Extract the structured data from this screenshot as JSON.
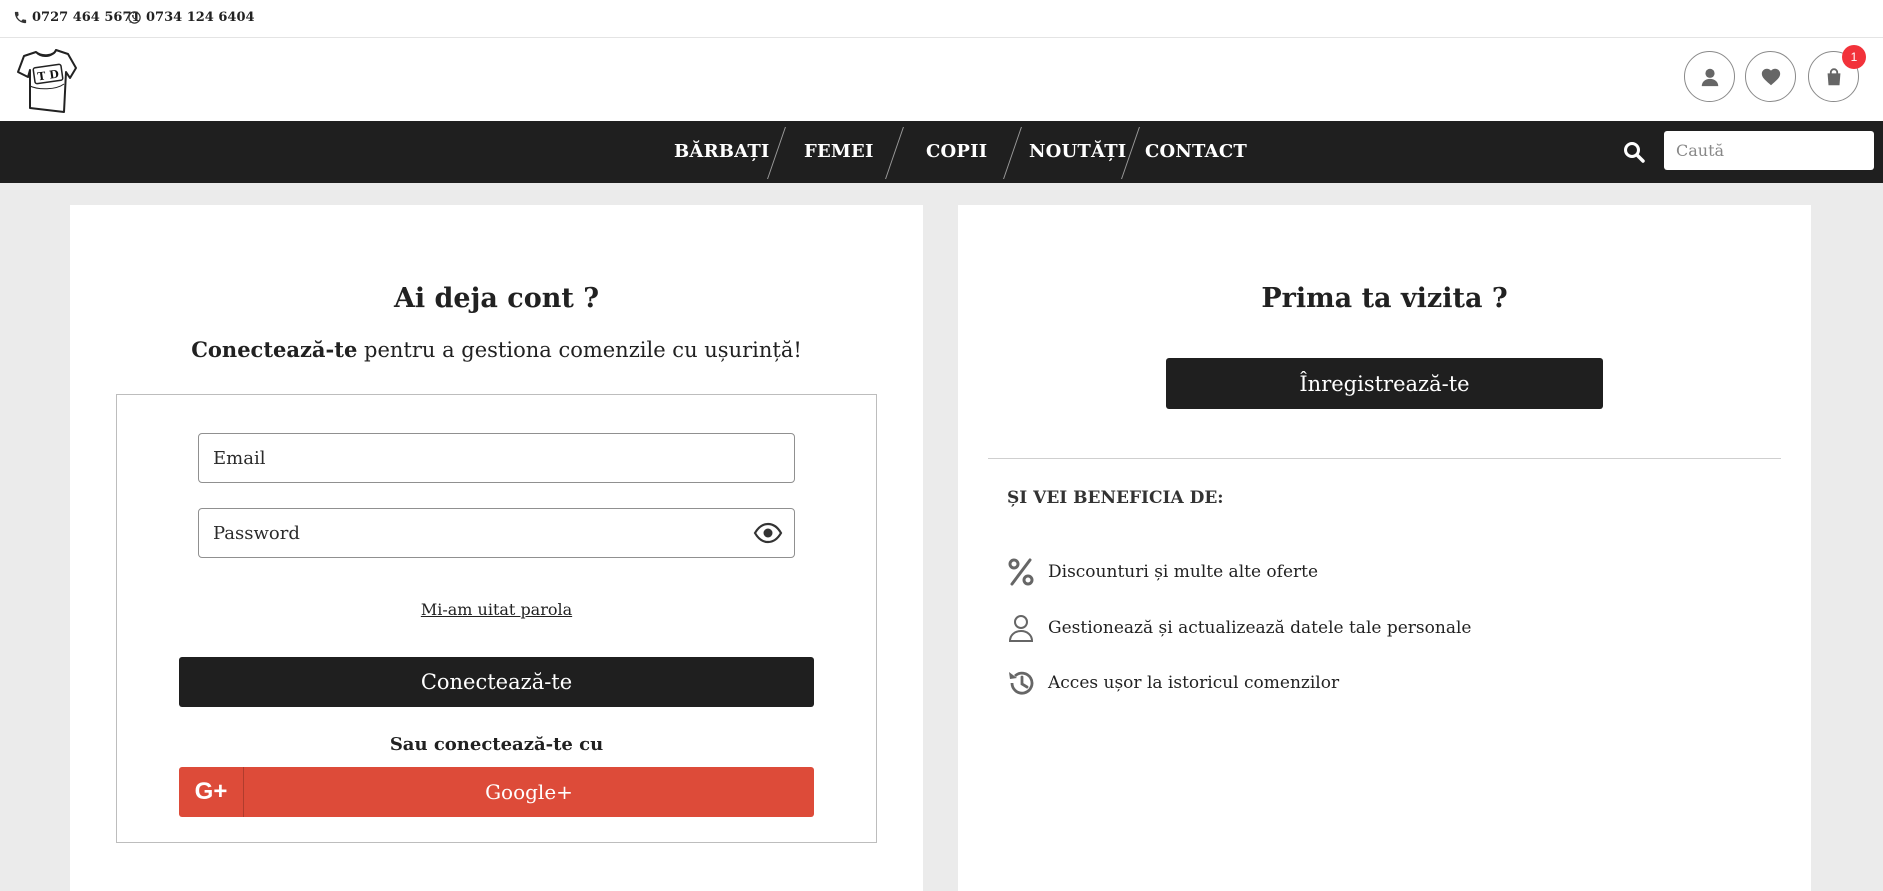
{
  "topbar": {
    "phone": "0727 464 5671",
    "whatsapp": "0734 124 6404"
  },
  "header": {
    "logo_text": "T D",
    "cart_count": "1"
  },
  "nav": {
    "items": [
      {
        "label": "BĂRBAȚI"
      },
      {
        "label": "FEMEI"
      },
      {
        "label": "COPII"
      },
      {
        "label": "NOUTĂȚI"
      },
      {
        "label": "CONTACT"
      }
    ],
    "search_placeholder": "Caută"
  },
  "login": {
    "title": "Ai deja cont ?",
    "subtitle_bold": "Conectează-te",
    "subtitle_rest": " pentru a gestiona comenzile cu ușurință!",
    "email_placeholder": "Email",
    "password_placeholder": "Password",
    "forgot_link": "Mi-am uitat parola",
    "submit_label": "Conectează-te",
    "or_text": "Sau conectează-te cu",
    "google_icon_text": "G+",
    "google_label": "Google+"
  },
  "register": {
    "title": "Prima ta vizita ?",
    "button_label": "Înregistrează-te",
    "benefits_heading": "ȘI VEI BENEFICIA DE:",
    "benefits": [
      {
        "icon": "percent-icon",
        "label": "Discounturi și multe alte oferte"
      },
      {
        "icon": "user-outline-icon",
        "label": "Gestionează și actualizează datele tale personale"
      },
      {
        "icon": "history-icon",
        "label": "Acces ușor la istoricul comenzilor"
      }
    ]
  },
  "colors": {
    "dark": "#1f1f1f",
    "google_red": "#dd4b39",
    "badge_red": "#f2323a",
    "page_bg": "#ebebeb"
  }
}
